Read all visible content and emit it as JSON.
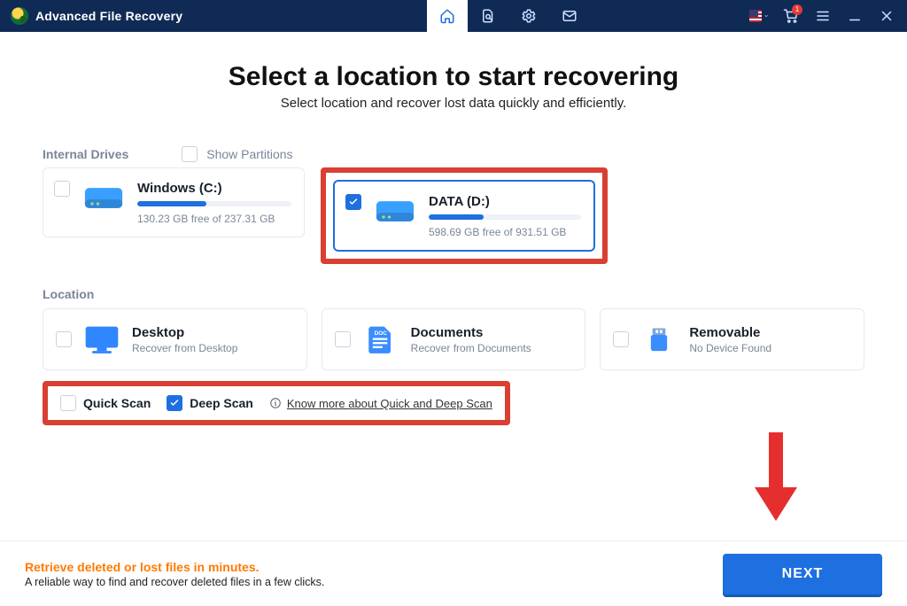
{
  "app": {
    "title": "Advanced File Recovery"
  },
  "header": {
    "tabs": [
      {
        "name": "home",
        "active": true
      },
      {
        "name": "scan-results"
      },
      {
        "name": "settings"
      },
      {
        "name": "feedback"
      }
    ],
    "cart_badge": "1"
  },
  "page": {
    "title": "Select a location to start recovering",
    "subtitle": "Select location and recover lost data quickly and efficiently."
  },
  "sections": {
    "drives_label": "Internal Drives",
    "show_partitions_label": "Show Partitions",
    "location_label": "Location"
  },
  "drives": [
    {
      "name": "Windows (C:)",
      "sub": "130.23 GB free of 237.31 GB",
      "used_pct": 45,
      "checked": false,
      "selected": false
    },
    {
      "name": "DATA (D:)",
      "sub": "598.69 GB free of 931.51 GB",
      "used_pct": 36,
      "checked": true,
      "selected": true
    }
  ],
  "locations": [
    {
      "name": "Desktop",
      "sub": "Recover from Desktop",
      "icon": "desktop"
    },
    {
      "name": "Documents",
      "sub": "Recover from Documents",
      "icon": "documents"
    },
    {
      "name": "Removable",
      "sub": "No Device Found",
      "icon": "usb"
    }
  ],
  "scan": {
    "quick_label": "Quick Scan",
    "deep_label": "Deep Scan",
    "quick_checked": false,
    "deep_checked": true,
    "know_more": "Know more about Quick and Deep Scan"
  },
  "footer": {
    "promo_title": "Retrieve deleted or lost files in minutes.",
    "promo_sub": "A reliable way to find and recover deleted files in a few clicks.",
    "next_label": "NEXT"
  }
}
